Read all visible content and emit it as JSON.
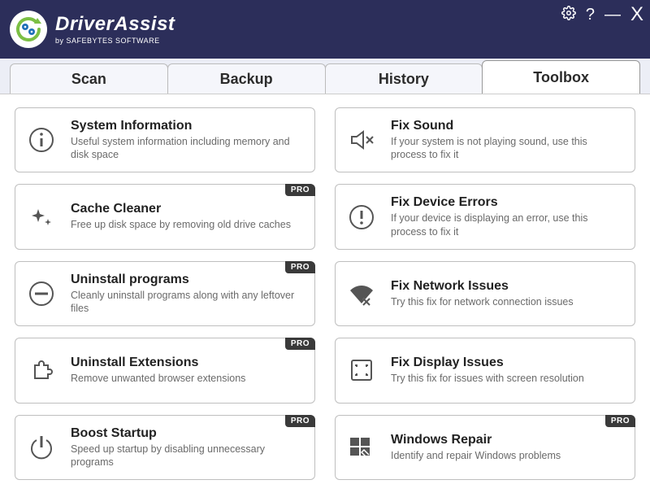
{
  "brand": {
    "name_part1": "Driver",
    "name_part2": "Assist",
    "subtitle": "by SAFEBYTES SOFTWARE"
  },
  "window_controls": {
    "settings": "⚙",
    "help": "?",
    "minimize": "—",
    "close": "X"
  },
  "tabs": [
    {
      "id": "scan",
      "label": "Scan",
      "active": false
    },
    {
      "id": "backup",
      "label": "Backup",
      "active": false
    },
    {
      "id": "history",
      "label": "History",
      "active": false
    },
    {
      "id": "toolbox",
      "label": "Toolbox",
      "active": true
    }
  ],
  "pro_label": "PRO",
  "tools": {
    "left": [
      {
        "icon": "info",
        "title": "System Information",
        "desc": "Useful system information including memory and disk space",
        "pro": false
      },
      {
        "icon": "sparkle",
        "title": "Cache Cleaner",
        "desc": "Free up disk space by removing old drive caches",
        "pro": true
      },
      {
        "icon": "minus-circle",
        "title": "Uninstall programs",
        "desc": "Cleanly uninstall programs along with any leftover files",
        "pro": true
      },
      {
        "icon": "puzzle",
        "title": "Uninstall Extensions",
        "desc": "Remove unwanted browser extensions",
        "pro": true
      },
      {
        "icon": "power",
        "title": "Boost Startup",
        "desc": "Speed up startup by disabling unnecessary programs",
        "pro": true
      }
    ],
    "right": [
      {
        "icon": "sound-x",
        "title": "Fix Sound",
        "desc": "If your system is not playing sound, use this process to fix it",
        "pro": false
      },
      {
        "icon": "alert",
        "title": "Fix Device Errors",
        "desc": "If your device is displaying an error, use this process to fix it",
        "pro": false
      },
      {
        "icon": "wifi-x",
        "title": "Fix Network Issues",
        "desc": "Try this fix for network connection issues",
        "pro": false
      },
      {
        "icon": "display",
        "title": "Fix Display Issues",
        "desc": "Try this fix for issues with screen resolution",
        "pro": false
      },
      {
        "icon": "windows-repair",
        "title": "Windows Repair",
        "desc": "Identify and repair Windows problems",
        "pro": true
      }
    ]
  }
}
